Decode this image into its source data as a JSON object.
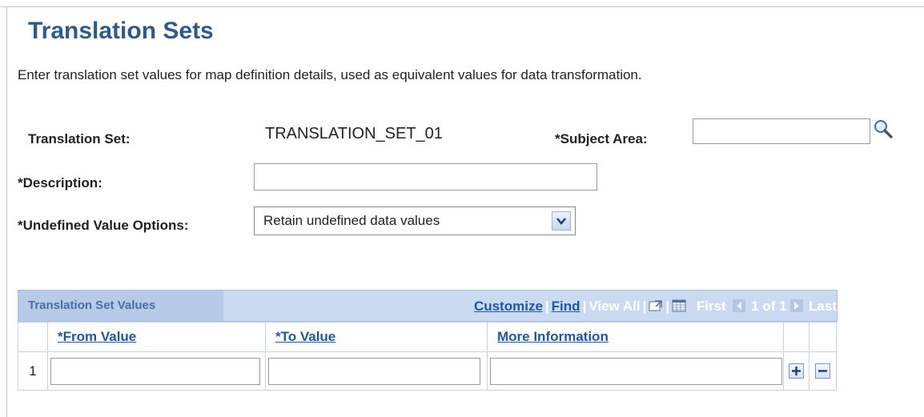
{
  "page": {
    "title": "Translation Sets",
    "description": "Enter translation set values for map definition details, used as equivalent values for data transformation."
  },
  "form": {
    "translation_set_label": "Translation Set:",
    "translation_set_value": "TRANSLATION_SET_01",
    "subject_area_label": "*Subject Area:",
    "subject_area_value": "",
    "description_label": "*Description:",
    "description_value": "",
    "undefined_value_label": "*Undefined Value Options:",
    "undefined_value_selected": "Retain undefined data values"
  },
  "grid": {
    "title": "Translation Set Values",
    "customize": "Customize",
    "find": "Find",
    "view_all": "View All",
    "first": "First",
    "page_info": "1 of 1",
    "last": "Last",
    "columns": [
      "*From Value",
      "*To Value",
      "More Information"
    ],
    "rows": [
      {
        "num": "1",
        "from_value": "",
        "to_value": "",
        "more_info": ""
      }
    ],
    "icons": [
      "new-window-icon",
      "download-grid-icon",
      "previous-arrow-icon",
      "next-arrow-icon",
      "add-row-icon",
      "delete-row-icon"
    ]
  },
  "colors": {
    "title": "#2e5a8d",
    "link": "#1f56a8",
    "grid_header_bg": "#c9daf1"
  }
}
